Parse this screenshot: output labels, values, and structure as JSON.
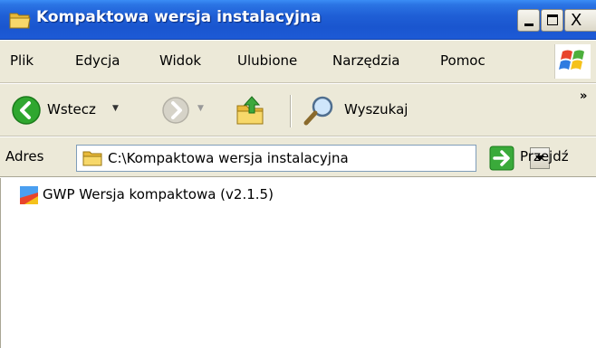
{
  "window": {
    "title": "Kompaktowa wersja instalacyjna",
    "title_icon": "folder-icon",
    "controls": {
      "minimize": "_",
      "maximize": "□",
      "close": "X"
    }
  },
  "menubar": {
    "items": [
      "Plik",
      "Edycja",
      "Widok",
      "Ulubione",
      "Narzędzia",
      "Pomoc"
    ]
  },
  "toolbar": {
    "back_label": "Wstecz",
    "search_label": "Wyszukaj",
    "overflow": "»"
  },
  "address": {
    "label": "Adres",
    "value": "C:\\Kompaktowa wersja instalacyjna",
    "go_label": "Przejdź"
  },
  "files": [
    {
      "name": "GWP Wersja kompaktowa (v2.1.5)",
      "icon": "application-icon"
    }
  ],
  "colors": {
    "titlebar": "#1f5fd6",
    "chrome": "#ece9d8",
    "back_green": "#2fa72f",
    "folder_yellow": "#f5d35a"
  }
}
